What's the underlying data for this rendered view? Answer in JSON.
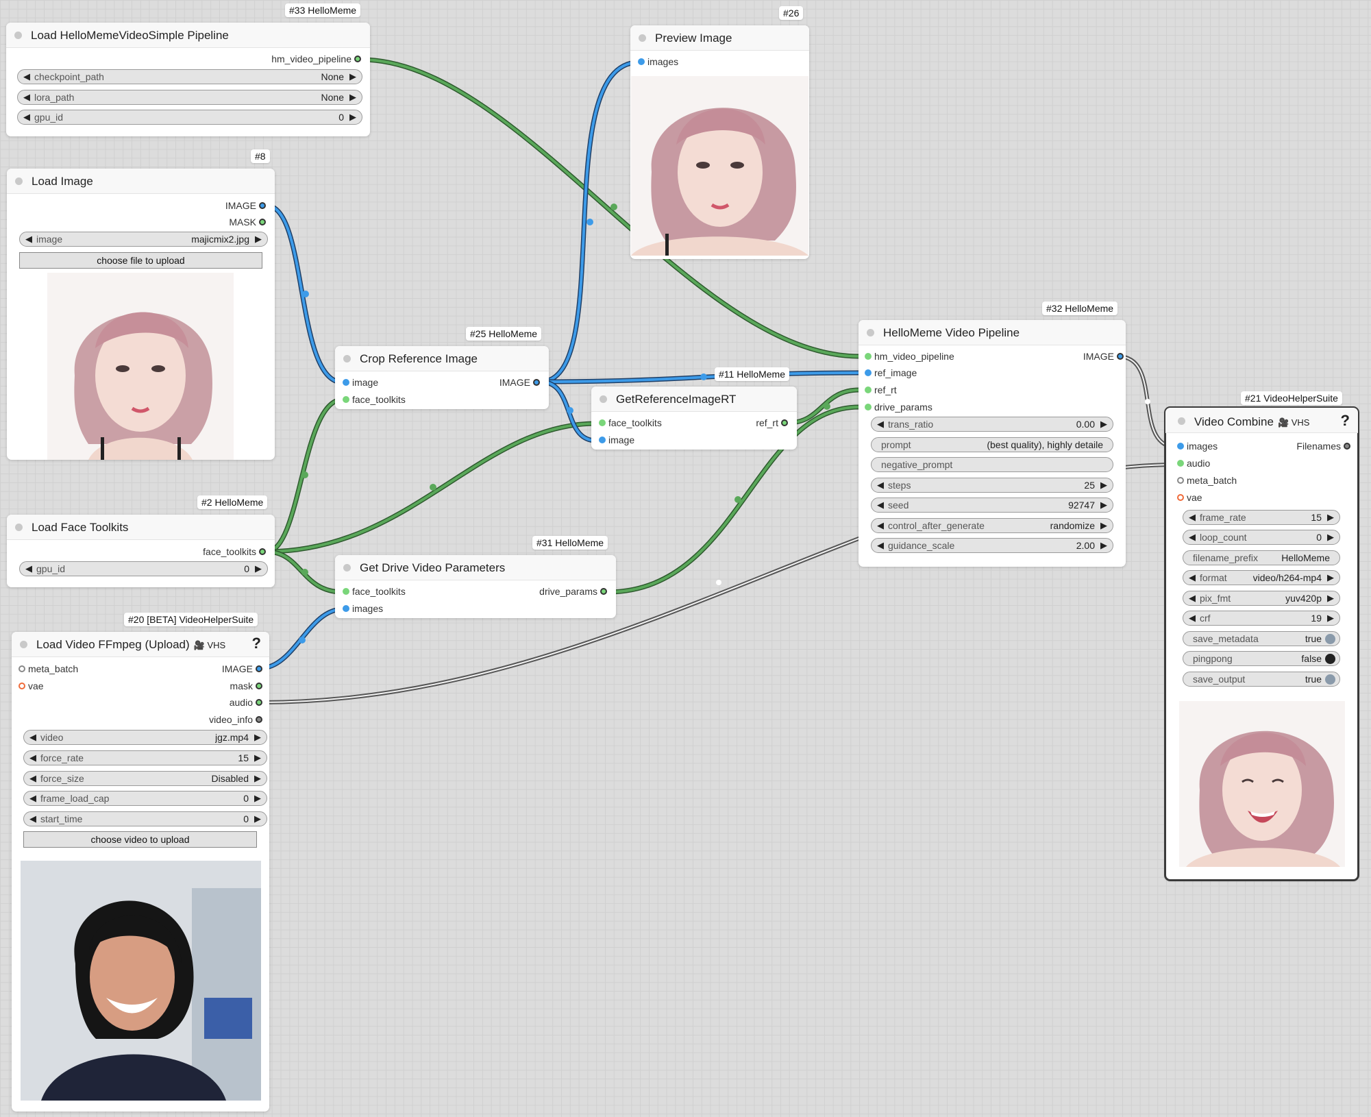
{
  "colors": {
    "background": "#dcdcdc",
    "wire_green": "#4f9a4f",
    "wire_blue": "#3a8fe0",
    "wire_gray": "#7a7a7a",
    "node": "#ffffff"
  },
  "nodes": {
    "n33": {
      "badge": "#33 HelloMeme",
      "title": "Load HelloMemeVideoSimple Pipeline",
      "outputs": [
        "hm_video_pipeline"
      ],
      "widgets": [
        {
          "label": "checkpoint_path",
          "value": "None"
        },
        {
          "label": "lora_path",
          "value": "None"
        },
        {
          "label": "gpu_id",
          "value": "0"
        }
      ]
    },
    "n8": {
      "badge": "#8",
      "title": "Load Image",
      "outputs": [
        "IMAGE",
        "MASK"
      ],
      "widgets": [
        {
          "label": "image",
          "value": "majicmix2.jpg"
        }
      ],
      "button": "choose file to upload"
    },
    "n2": {
      "badge": "#2 HelloMeme",
      "title": "Load Face Toolkits",
      "outputs": [
        "face_toolkits"
      ],
      "widgets": [
        {
          "label": "gpu_id",
          "value": "0"
        }
      ]
    },
    "n20": {
      "badge": "#20 [BETA] VideoHelperSuite",
      "title": "Load Video FFmpeg (Upload)",
      "suite": "VHS",
      "help": "?",
      "inputs": [
        "meta_batch",
        "vae"
      ],
      "outputs": [
        "IMAGE",
        "mask",
        "audio",
        "video_info"
      ],
      "widgets": [
        {
          "label": "video",
          "value": "jgz.mp4"
        },
        {
          "label": "force_rate",
          "value": "15"
        },
        {
          "label": "force_size",
          "value": "Disabled"
        },
        {
          "label": "frame_load_cap",
          "value": "0"
        },
        {
          "label": "start_time",
          "value": "0"
        }
      ],
      "button": "choose video to upload"
    },
    "n25": {
      "badge": "#25 HelloMeme",
      "title": "Crop Reference Image",
      "inputs": [
        "image",
        "face_toolkits"
      ],
      "outputs": [
        "IMAGE"
      ]
    },
    "n26": {
      "badge": "#26",
      "title": "Preview Image",
      "inputs": [
        "images"
      ]
    },
    "n11": {
      "badge": "#11 HelloMeme",
      "title": "GetReferenceImageRT",
      "inputs": [
        "face_toolkits",
        "image"
      ],
      "outputs": [
        "ref_rt"
      ]
    },
    "n31": {
      "badge": "#31 HelloMeme",
      "title": "Get Drive Video Parameters",
      "inputs": [
        "face_toolkits",
        "images"
      ],
      "outputs": [
        "drive_params"
      ]
    },
    "n32": {
      "badge": "#32 HelloMeme",
      "title": "HelloMeme Video Pipeline",
      "inputs": [
        "hm_video_pipeline",
        "ref_image",
        "ref_rt",
        "drive_params"
      ],
      "outputs": [
        "IMAGE"
      ],
      "widgets": [
        {
          "label": "trans_ratio",
          "value": "0.00"
        },
        {
          "label": "prompt",
          "value": "(best quality), highly detaile"
        },
        {
          "label": "negative_prompt",
          "value": ""
        },
        {
          "label": "steps",
          "value": "25"
        },
        {
          "label": "seed",
          "value": "92747"
        },
        {
          "label": "control_after_generate",
          "value": "randomize"
        },
        {
          "label": "guidance_scale",
          "value": "2.00"
        }
      ]
    },
    "n21": {
      "badge": "#21 VideoHelperSuite",
      "title": "Video Combine",
      "suite": "VHS",
      "help": "?",
      "inputs": [
        "images",
        "audio",
        "meta_batch",
        "vae"
      ],
      "outputs": [
        "Filenames"
      ],
      "widgets": [
        {
          "label": "frame_rate",
          "value": "15"
        },
        {
          "label": "loop_count",
          "value": "0"
        },
        {
          "label": "filename_prefix",
          "value": "HelloMeme"
        },
        {
          "label": "format",
          "value": "video/h264-mp4"
        },
        {
          "label": "pix_fmt",
          "value": "yuv420p"
        },
        {
          "label": "crf",
          "value": "19"
        },
        {
          "label": "save_metadata",
          "value": "true"
        },
        {
          "label": "pingpong",
          "value": "false"
        },
        {
          "label": "save_output",
          "value": "true"
        }
      ]
    }
  }
}
